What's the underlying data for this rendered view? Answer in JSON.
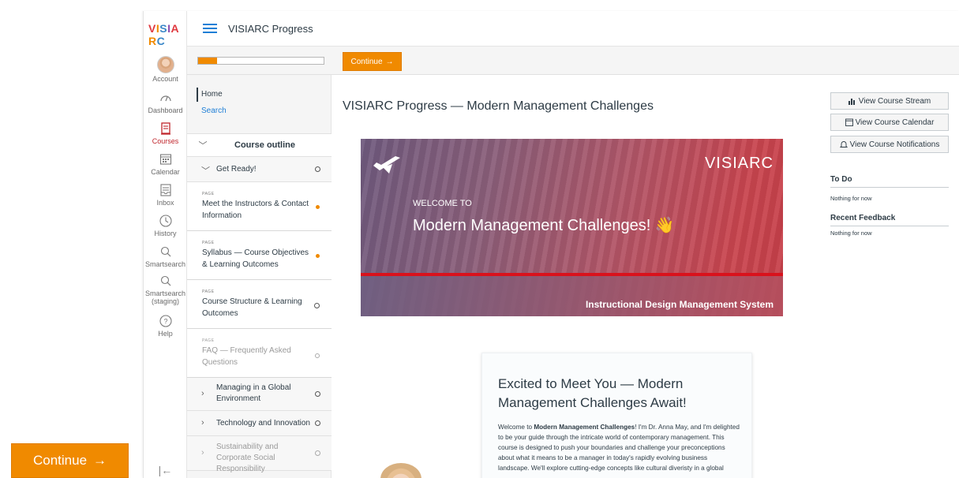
{
  "float_continue": {
    "label": "Continue",
    "arrow": "→"
  },
  "global_nav": {
    "logo": "VISIARC",
    "logo_colors": [
      "#e0383e",
      "#f08a00",
      "#3a87c8",
      "#8d4fb0"
    ],
    "items": [
      {
        "label": "Account",
        "icon": "avatar"
      },
      {
        "label": "Dashboard",
        "icon": "dashboard-icon"
      },
      {
        "label": "Courses",
        "icon": "courses-icon",
        "active": true
      },
      {
        "label": "Calendar",
        "icon": "calendar-icon"
      },
      {
        "label": "Inbox",
        "icon": "inbox-icon"
      },
      {
        "label": "History",
        "icon": "history-icon"
      },
      {
        "label": "Smartsearch",
        "icon": "search-icon"
      },
      {
        "label": "Smartsearch (staging)",
        "icon": "search-icon"
      },
      {
        "label": "Help",
        "icon": "help-icon"
      }
    ],
    "collapse_glyph": "|←"
  },
  "topbar": {
    "title": "VISIARC Progress"
  },
  "progress": {
    "fraction": 0.15,
    "continue_label": "Continue",
    "arrow": "→",
    "accent": "#f08a00"
  },
  "course_nav": {
    "home": "Home",
    "search": "Search",
    "outline_title": "Course outline"
  },
  "outline": {
    "get_ready": "Get Ready!",
    "pages": [
      {
        "kind": "PAGE",
        "title": "Meet the Instructors & Contact Information",
        "status": "current"
      },
      {
        "kind": "PAGE",
        "title": "Syllabus — Course Objectives & Learning Outcomes",
        "status": "current"
      },
      {
        "kind": "PAGE",
        "title": "Course Structure & Learning Outcomes",
        "status": "open"
      },
      {
        "kind": "PAGE",
        "title": "FAQ — Frequently Asked Questions",
        "status": "locked"
      }
    ],
    "modules": [
      "Managing in a Global Environment",
      "Technology and Innovation",
      "Sustainability and Corporate Social Responsibility"
    ]
  },
  "main": {
    "page_title": "VISIARC Progress — Modern Management Challenges",
    "banner": {
      "brand": "VISIARC",
      "welcome": "WELCOME TO",
      "headline": "Modern Management Challenges! 👋",
      "subline": "Instructional Design Management System"
    },
    "card": {
      "heading": "Excited to Meet You — Modern Management Challenges Await!",
      "intro": "Welcome to ",
      "intro_bold": "Modern Management Challenges",
      "body": "! I'm Dr. Anna May, and I'm delighted to be your guide through the intricate world of contemporary management. This course is designed to push your boundaries and challenge your preconceptions about what it means to be a manager in today's rapidly evolving business landscape. We'll explore cutting-edge concepts like cultural diveristy in a global"
    }
  },
  "right_sidebar": {
    "stream_btn": "View Course Stream",
    "calendar_btn": "View Course Calendar",
    "notifications_btn": "View Course Notifications",
    "todo_title": "To Do",
    "todo_empty": "Nothing for now",
    "feedback_title": "Recent Feedback",
    "feedback_empty": "Nothing for now"
  }
}
